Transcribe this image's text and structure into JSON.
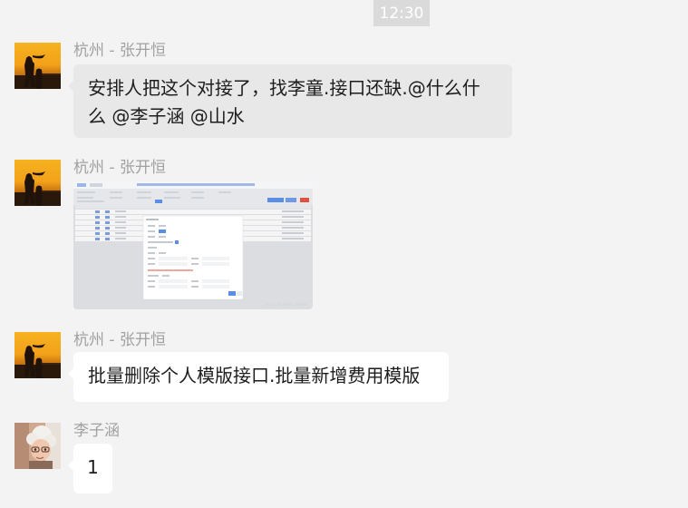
{
  "time": "12:30",
  "messages": [
    {
      "sender": "杭州 - 张开恒",
      "avatar_icon": "sunset-silhouette-avatar",
      "text": "安排人把这个对接了，找李童.接口还缺.@什么什么 @李子涵 @山水"
    },
    {
      "sender": "杭州 - 张开恒",
      "avatar_icon": "sunset-silhouette-avatar",
      "content_type": "image"
    },
    {
      "sender": "杭州 - 张开恒",
      "avatar_icon": "sunset-silhouette-avatar",
      "text": "批量删除个人模版接口.批量新增费用模版"
    },
    {
      "sender": "李子涵",
      "avatar_icon": "granny-cartoon-avatar",
      "text": "1"
    }
  ],
  "colors": {
    "background": "#f3f3f3",
    "bubble_self": "#e8e8e8",
    "bubble_white": "#ffffff",
    "sender_text": "#a1a1a1",
    "time_badge": "#dadada"
  }
}
